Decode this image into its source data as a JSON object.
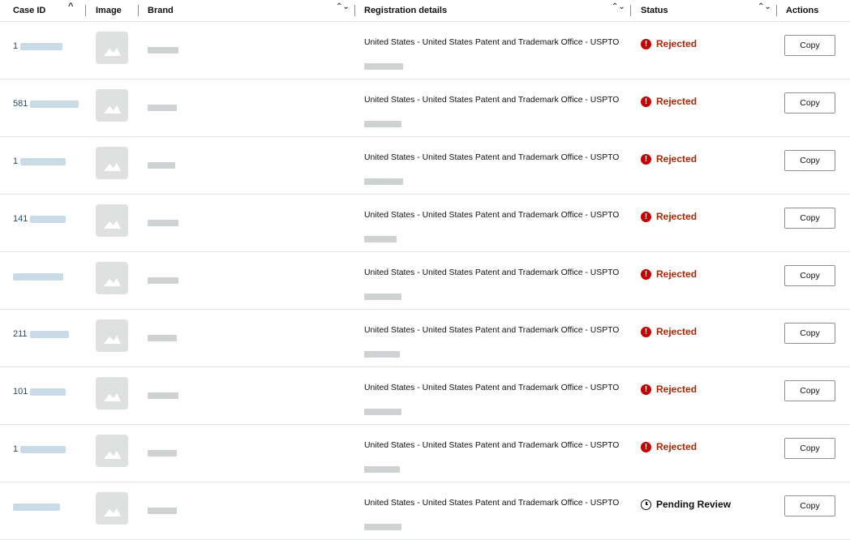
{
  "table": {
    "headers": {
      "case_id": "Case ID",
      "image": "Image",
      "brand": "Brand",
      "registration": "Registration details",
      "status": "Status",
      "actions": "Actions"
    },
    "sort_icons": {
      "case_id": "^",
      "brand": "⌃⌄",
      "registration": "⌃⌄",
      "status": "⌃⌄"
    },
    "rows": [
      {
        "case_id": "1",
        "registration": "United States - United States Patent and Trademark Office - USPTO",
        "status": "Rejected",
        "status_type": "rejected",
        "action": "Copy"
      },
      {
        "case_id": "581",
        "registration": "United States - United States Patent and Trademark Office - USPTO",
        "status": "Rejected",
        "status_type": "rejected",
        "action": "Copy"
      },
      {
        "case_id": "1",
        "registration": "United States - United States Patent and Trademark Office - USPTO",
        "status": "Rejected",
        "status_type": "rejected",
        "action": "Copy"
      },
      {
        "case_id": "141",
        "registration": "United States - United States Patent and Trademark Office - USPTO",
        "status": "Rejected",
        "status_type": "rejected",
        "action": "Copy"
      },
      {
        "case_id": "",
        "registration": "United States - United States Patent and Trademark Office - USPTO",
        "status": "Rejected",
        "status_type": "rejected",
        "action": "Copy"
      },
      {
        "case_id": "211",
        "registration": "United States - United States Patent and Trademark Office - USPTO",
        "status": "Rejected",
        "status_type": "rejected",
        "action": "Copy"
      },
      {
        "case_id": "101",
        "registration": "United States - United States Patent and Trademark Office - USPTO",
        "status": "Rejected",
        "status_type": "rejected",
        "action": "Copy"
      },
      {
        "case_id": "1",
        "registration": "United States - United States Patent and Trademark Office - USPTO",
        "status": "Rejected",
        "status_type": "rejected",
        "action": "Copy"
      },
      {
        "case_id": "",
        "registration": "United States - United States Patent and Trademark Office - USPTO",
        "status": "Pending Review",
        "status_type": "pending",
        "action": "Copy"
      }
    ]
  },
  "colors": {
    "rejected": "#b12704",
    "rejected_icon": "#c40000",
    "border": "#e3e6e6",
    "link": "#1f4b6e"
  },
  "icons": {
    "rejected": "exclamation-circle-icon",
    "pending": "clock-icon",
    "image": "image-placeholder-icon"
  }
}
